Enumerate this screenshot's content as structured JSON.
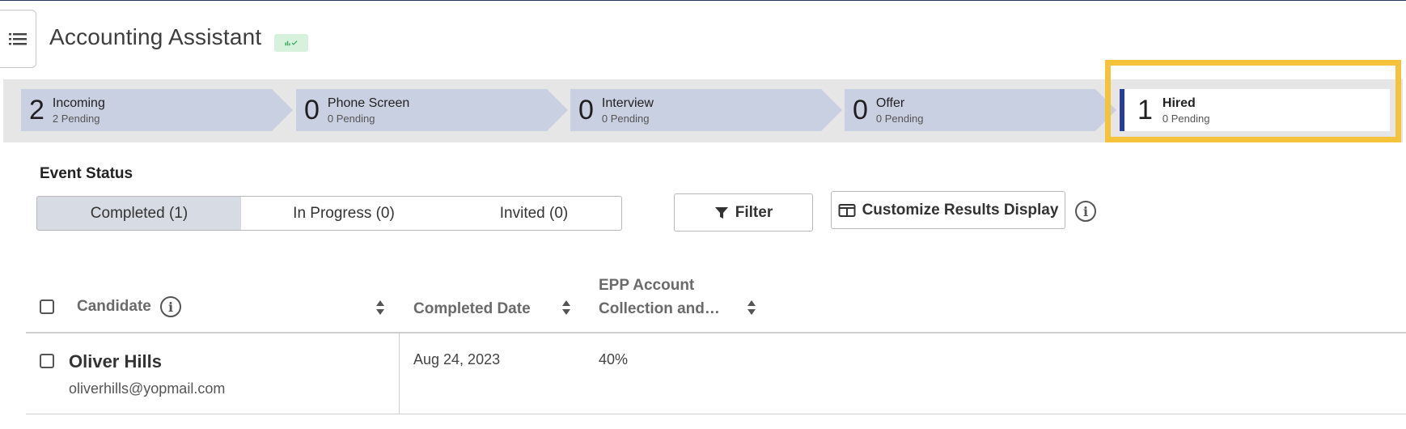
{
  "header": {
    "title": "Accounting Assistant"
  },
  "pipeline": {
    "stages": [
      {
        "count": "2",
        "name": "Incoming",
        "pending": "2 Pending"
      },
      {
        "count": "0",
        "name": "Phone Screen",
        "pending": "0 Pending"
      },
      {
        "count": "0",
        "name": "Interview",
        "pending": "0 Pending"
      },
      {
        "count": "0",
        "name": "Offer",
        "pending": "0 Pending"
      },
      {
        "count": "1",
        "name": "Hired",
        "pending": "0 Pending"
      }
    ],
    "highlight_color": "#f5c23b",
    "active_stage_accent": "#283d94"
  },
  "event_status": {
    "label": "Event Status",
    "tabs": [
      {
        "label": "Completed (1)",
        "active": true
      },
      {
        "label": "In Progress (0)",
        "active": false
      },
      {
        "label": "Invited (0)",
        "active": false
      }
    ],
    "filter_label": "Filter",
    "customize_label": "Customize Results Display"
  },
  "table": {
    "columns": [
      "Candidate",
      "Completed Date",
      "EPP Account",
      "Collection and…"
    ],
    "rows": [
      {
        "name": "Oliver Hills",
        "email": "oliverhills@yopmail.com",
        "completed_date": "Aug 24, 2023",
        "score": "40%"
      }
    ]
  },
  "icons": {
    "menu": "list-icon",
    "badge": "chart-check-icon",
    "filter": "funnel-icon",
    "customize": "columns-icon",
    "info": "info-icon",
    "sort": "sort-icon"
  }
}
